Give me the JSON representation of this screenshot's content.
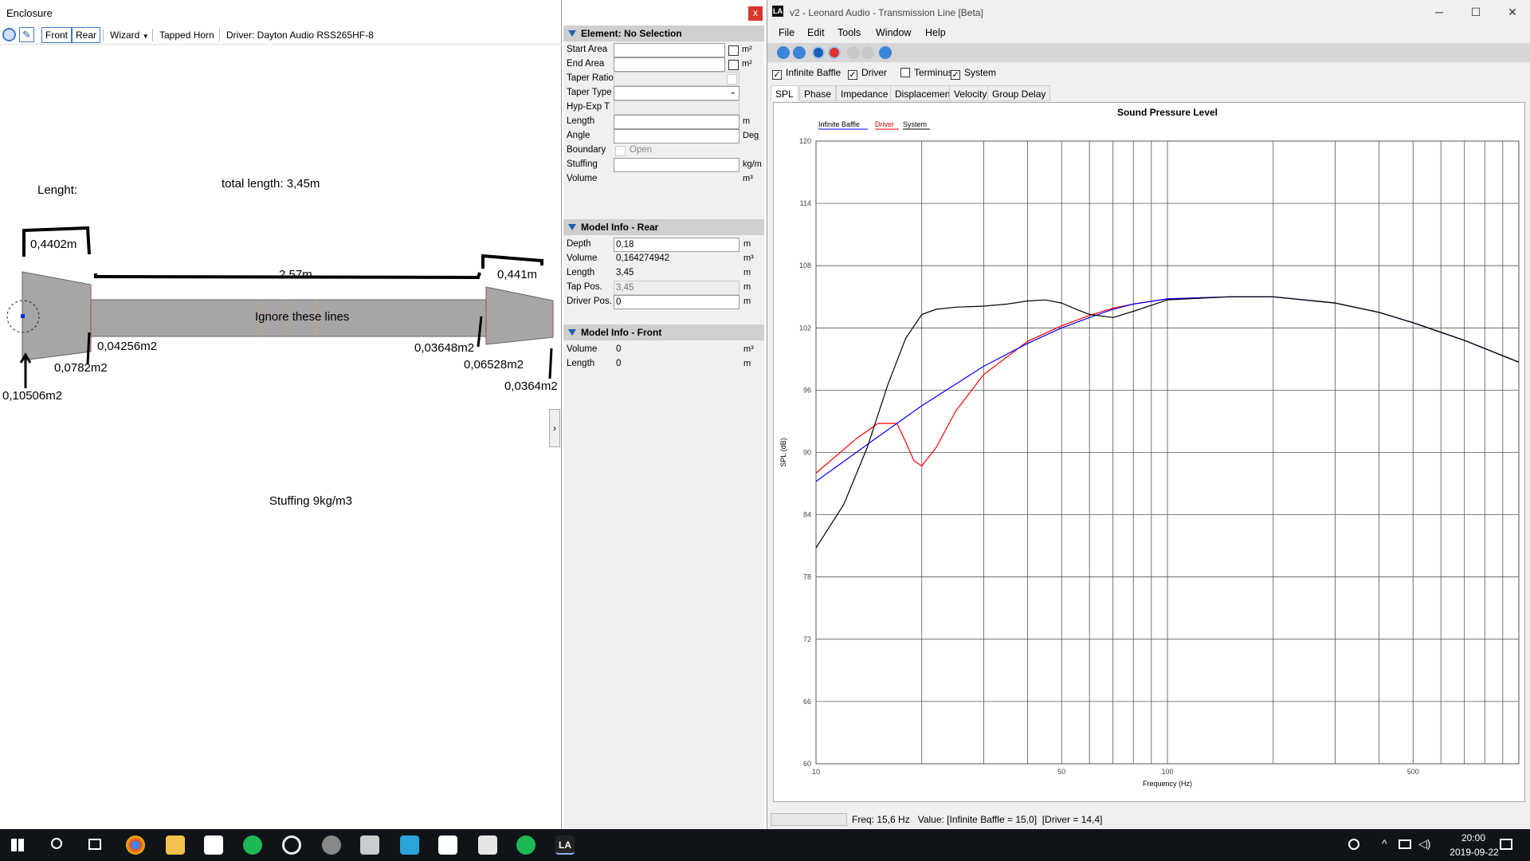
{
  "enclosure": {
    "title": "Enclosure",
    "toolbar": {
      "front": "Front",
      "rear": "Rear",
      "wizard": "Wizard",
      "mode": "Tapped Horn",
      "driver": "Driver: Dayton Audio RSS265HF-8"
    },
    "annotations": {
      "length_label": "Lenght:",
      "total": "total length: 3,45m",
      "seg1": "0,4402m",
      "seg2": "2.57m",
      "seg3": "0,441m",
      "ignore": "Ignore these lines",
      "a1": "0,10506m2",
      "a2": "0,0782m2",
      "a3": "0,04256m2",
      "a4": "0,03648m2",
      "a5": "0,06528m2",
      "a6": "0,0364m2",
      "stuffing": "Stuffing 9kg/m3"
    },
    "close_glyph": "x",
    "expand_glyph": "›"
  },
  "props": {
    "element_header": "Element: No Selection",
    "rows": [
      {
        "label": "Start Area",
        "unit": "m²"
      },
      {
        "label": "End Area",
        "unit": "m²"
      },
      {
        "label": "Taper Ratio",
        "unit": ""
      },
      {
        "label": "Taper Type",
        "unit": ""
      },
      {
        "label": "Hyp-Exp T",
        "unit": ""
      },
      {
        "label": "Length",
        "unit": "m"
      },
      {
        "label": "Angle",
        "unit": "Deg"
      },
      {
        "label": "Boundary",
        "unit": "",
        "option": "Open"
      },
      {
        "label": "Stuffing",
        "unit": "kg/m"
      },
      {
        "label": "Volume",
        "unit": "m³"
      }
    ],
    "rear_header": "Model Info - Rear",
    "rear": [
      {
        "label": "Depth",
        "value": "0,18",
        "unit": "m"
      },
      {
        "label": "Volume",
        "value": "0,164274942",
        "unit": "m³"
      },
      {
        "label": "Length",
        "value": "3,45",
        "unit": "m"
      },
      {
        "label": "Tap Pos.",
        "value": "3,45",
        "unit": "m"
      },
      {
        "label": "Driver Pos.",
        "value": "0",
        "unit": "m"
      }
    ],
    "front_header": "Model Info - Front",
    "front": [
      {
        "label": "Volume",
        "value": "0",
        "unit": "m³"
      },
      {
        "label": "Length",
        "value": "0",
        "unit": "m"
      }
    ]
  },
  "la": {
    "title": "v2 - Leonard Audio - Transmission Line [Beta]",
    "menu": [
      "File",
      "Edit",
      "Tools",
      "Window",
      "Help"
    ],
    "checks": [
      {
        "label": "Infinite Baffle",
        "checked": true
      },
      {
        "label": "Driver",
        "checked": true
      },
      {
        "label": "Terminus",
        "checked": false
      },
      {
        "label": "System",
        "checked": true
      }
    ],
    "tabs": [
      "SPL",
      "Phase",
      "Impedance",
      "Displacement",
      "Velocity",
      "Group Delay"
    ],
    "status": "Freq: 15,6 Hz   Value: [Infinite Baffle = 15,0]  [Driver = 14,4]"
  },
  "taskbar": {
    "time": "20:00",
    "date": "2019-09-22"
  },
  "chart_data": {
    "type": "line",
    "title": "Sound Pressure Level",
    "xlabel": "Frequency (Hz)",
    "ylabel": "SPL (dB)",
    "xscale": "log",
    "xlim": [
      10,
      1000
    ],
    "ylim": [
      60,
      120
    ],
    "yticks": [
      60,
      66,
      72,
      78,
      84,
      90,
      96,
      102,
      108,
      114,
      120
    ],
    "xtick_labels": [
      {
        "v": 10,
        "t": "10"
      },
      {
        "v": 50,
        "t": "50"
      },
      {
        "v": 100,
        "t": "100"
      },
      {
        "v": 500,
        "t": "500"
      }
    ],
    "legend": [
      "Infinite Baffle",
      "Driver",
      "System"
    ],
    "series": [
      {
        "name": "Infinite Baffle",
        "color": "#0000ff",
        "x": [
          10,
          15,
          20,
          30,
          40,
          50,
          60,
          70,
          80,
          100,
          150,
          200,
          300,
          400,
          500,
          700,
          1000
        ],
        "y": [
          87.2,
          91.5,
          94.5,
          98.3,
          100.5,
          102.0,
          103.0,
          103.8,
          104.3,
          104.8,
          105.0,
          105.0,
          104.4,
          103.5,
          102.5,
          100.8,
          98.7
        ]
      },
      {
        "name": "Driver",
        "color": "#ff0000",
        "x": [
          10,
          13,
          15,
          17,
          18,
          19,
          20,
          22,
          25,
          30,
          40,
          50,
          60,
          70,
          80,
          100,
          150,
          200,
          300,
          400,
          500,
          700,
          1000
        ],
        "y": [
          88.0,
          91.3,
          92.8,
          92.8,
          91.0,
          89.2,
          88.7,
          90.5,
          94.0,
          97.5,
          100.7,
          102.2,
          103.2,
          103.9,
          104.3,
          104.8,
          105.0,
          105.0,
          104.4,
          103.5,
          102.5,
          100.8,
          98.7
        ]
      },
      {
        "name": "System",
        "color": "#000000",
        "x": [
          10,
          12,
          14,
          16,
          18,
          20,
          22,
          25,
          30,
          35,
          40,
          45,
          50,
          55,
          60,
          70,
          80,
          100,
          150,
          200,
          300,
          400,
          500,
          700,
          1000
        ],
        "y": [
          80.8,
          85.0,
          90.5,
          96.5,
          101.0,
          103.3,
          103.8,
          104.0,
          104.1,
          104.3,
          104.6,
          104.7,
          104.4,
          103.8,
          103.3,
          103.0,
          103.6,
          104.7,
          105.0,
          105.0,
          104.4,
          103.5,
          102.5,
          100.8,
          98.7
        ]
      }
    ]
  }
}
